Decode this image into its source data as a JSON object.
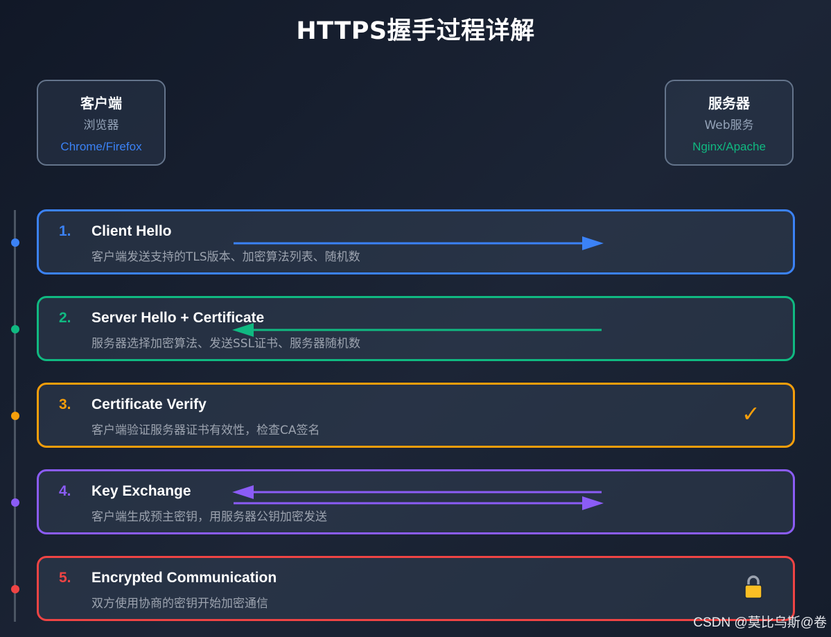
{
  "title": "HTTPS握手过程详解",
  "client": {
    "title": "客户端",
    "subtitle": "浏览器",
    "tech": "Chrome/Firefox"
  },
  "server": {
    "title": "服务器",
    "subtitle": "Web服务",
    "tech": "Nginx/Apache"
  },
  "steps": [
    {
      "number": "1.",
      "title": "Client Hello",
      "description": "客户端发送支持的TLS版本、加密算法列表、随机数",
      "direction": "client-to-server",
      "color": "#3b82f6"
    },
    {
      "number": "2.",
      "title": "Server Hello + Certificate",
      "description": "服务器选择加密算法、发送SSL证书、服务器随机数",
      "direction": "server-to-client",
      "color": "#10b981"
    },
    {
      "number": "3.",
      "title": "Certificate Verify",
      "description": "客户端验证服务器证书有效性，检查CA签名",
      "direction": "local",
      "icon": "check-icon",
      "icon_text": "✓",
      "color": "#f59e0b"
    },
    {
      "number": "4.",
      "title": "Key Exchange",
      "description": "客户端生成预主密钥，用服务器公钥加密发送",
      "direction": "bidirectional",
      "color": "#8b5cf6"
    },
    {
      "number": "5.",
      "title": "Encrypted Communication",
      "description": "双方使用协商的密钥开始加密通信",
      "direction": "local",
      "icon": "lock-icon",
      "color": "#ef4444"
    }
  ],
  "colors": {
    "client_accent": "#3b82f6",
    "server_accent": "#10b981"
  },
  "watermark": "CSDN @莫比乌斯@卷"
}
